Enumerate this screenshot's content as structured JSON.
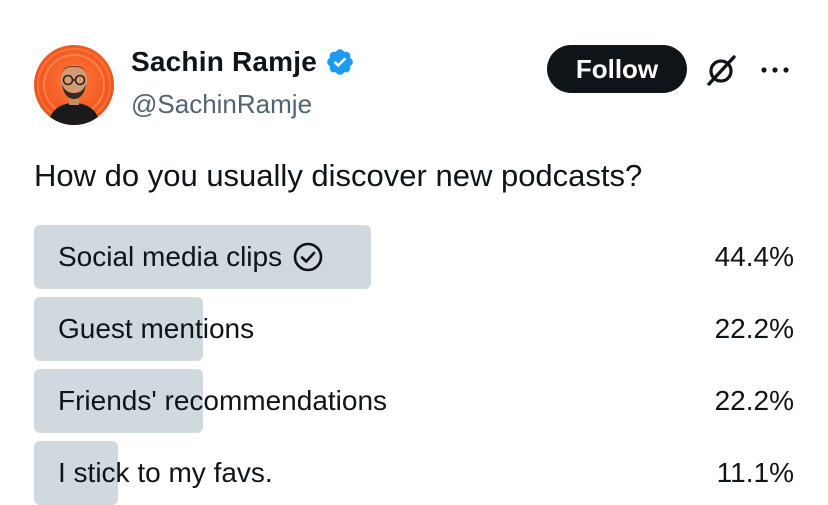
{
  "author": {
    "name": "Sachin Ramje",
    "handle": "@SachinRamje",
    "verified": true
  },
  "actions": {
    "follow_label": "Follow",
    "grok_icon": "grok-icon",
    "more_icon": "more-icon"
  },
  "poll": {
    "question": "How do you usually discover new podcasts?",
    "options": [
      {
        "label": "Social media clips",
        "percent": "44.4%",
        "value": 44.4,
        "selected": true
      },
      {
        "label": "Guest mentions",
        "percent": "22.2%",
        "value": 22.2,
        "selected": false
      },
      {
        "label": "Friends' recommendations",
        "percent": "22.2%",
        "value": 22.2,
        "selected": false
      },
      {
        "label": "I stick to my favs.",
        "percent": "11.1%",
        "value": 11.1,
        "selected": false
      }
    ]
  },
  "colors": {
    "text": "#0f1419",
    "secondary_text": "#536471",
    "poll_bar": "#cfd9de",
    "follow_bg": "#0f1419",
    "verified_badge": "#1d9bf0",
    "avatar_bg": "#f25a20"
  }
}
